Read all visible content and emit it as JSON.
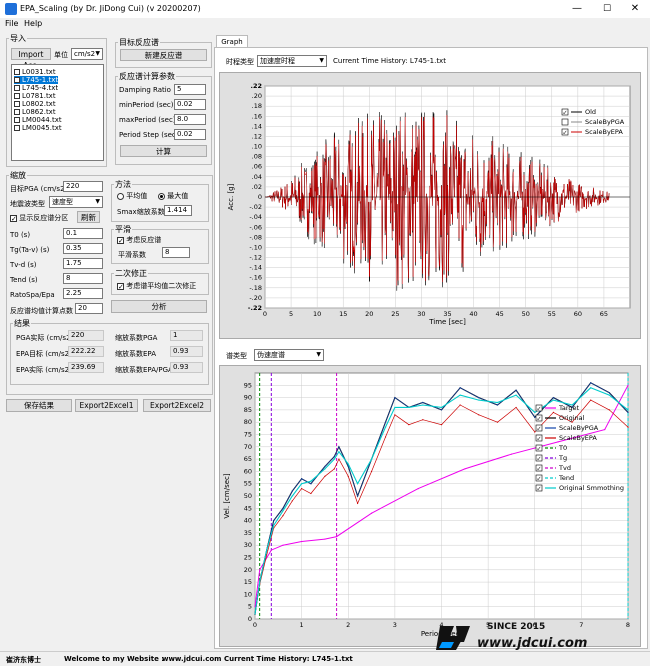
{
  "window": {
    "title": "EPA_Scaling (by Dr. JiDong Cui) (v 20200207)",
    "min_glyph": "—",
    "max_glyph": "☐",
    "close_glyph": "✕"
  },
  "menu": {
    "file": "File",
    "help": "Help"
  },
  "import_group": {
    "label": "导入",
    "import_button": "Import Acc.",
    "unit_label": "单位",
    "unit_value": "cm/s2",
    "files": [
      {
        "name": "L0031.txt",
        "checked": false,
        "selected": false
      },
      {
        "name": "L745-1.txt",
        "checked": false,
        "selected": true
      },
      {
        "name": "L745-4.txt",
        "checked": false,
        "selected": false
      },
      {
        "name": "L0781.txt",
        "checked": false,
        "selected": false
      },
      {
        "name": "L0802.txt",
        "checked": false,
        "selected": false
      },
      {
        "name": "L0862.txt",
        "checked": false,
        "selected": false
      },
      {
        "name": "LM0044.txt",
        "checked": false,
        "selected": false
      },
      {
        "name": "LM0045.txt",
        "checked": false,
        "selected": false
      }
    ]
  },
  "target_spectrum_group": {
    "label": "目标反应谱",
    "new_button": "新建反应谱"
  },
  "spectrum_params": {
    "label": "反应谱计算参数",
    "damping_label": "Damping Ratio",
    "damping_value": "5",
    "minperiod_label": "minPeriod (sec)",
    "minperiod_value": "0.02",
    "maxperiod_label": "maxPeriod (sec)",
    "maxperiod_value": "8.0",
    "step_label": "Period Step (sec)",
    "step_value": "0.02",
    "calc_button": "计算"
  },
  "scaling_group": {
    "label": "缩放",
    "target_pga_label": "目标PGA (cm/s2)",
    "target_pga_value": "220",
    "site_type_label": "地震波类型",
    "site_type_value": "速度型",
    "show_spectrum_label": "显示反应谱分区",
    "refresh_button": "刷新",
    "t0_label": "T0 (s)",
    "t0_value": "0.1",
    "tg_label": "Tg(Ta-v) (s)",
    "tg_value": "0.35",
    "tvd_label": "Tv-d (s)",
    "tvd_value": "1.75",
    "tend_label": "Tend (s)",
    "tend_value": "8",
    "ratio_label": "RatoSpa/Epa",
    "ratio_value": "2.25",
    "points_label": "反应谱均值计算点数",
    "points_value": "20"
  },
  "method_group": {
    "label": "方法",
    "avg_label": "平均值",
    "max_label": "最大值",
    "smax_label": "Smax缩放系数",
    "smax_value": "1.414"
  },
  "smooth_group": {
    "label": "平滑",
    "consider_label": "考虑反应谱",
    "coef_label": "平滑系数",
    "coef_value": "8"
  },
  "second_fix_group": {
    "label": "二次修正",
    "consider_label": "考虑谱平均值二次修正",
    "analyze_button": "分析"
  },
  "results_group": {
    "label": "结果",
    "pga_actual_label": "PGA实际 (cm/s2)",
    "pga_actual_value": "220",
    "epa_target_label": "EPA目标 (cm/s2)",
    "epa_target_value": "222.22",
    "epa_actual_label": "EPA实际 (cm/s2)",
    "epa_actual_value": "239.69",
    "scale_pga_label": "缩放系数PGA",
    "scale_pga_value": "1",
    "scale_epa_label": "缩放系数EPA",
    "scale_epa_value": "0.93",
    "scale_ratio_label": "缩放系数EPA/PGA",
    "scale_ratio_value": "0.93"
  },
  "bottom_buttons": {
    "save": "保存结果",
    "excel1": "Export2Excel1",
    "excel2": "Export2Excel2"
  },
  "graph": {
    "tab_label": "Graph",
    "history_type_label": "时程类型",
    "history_type_value": "加速度时程",
    "current_history": "Current Time History: L745-1.txt",
    "spectrum_type_label": "谱类型",
    "spectrum_type_value": "伪速度谱"
  },
  "colors": {
    "accent": "#0078d7",
    "old": "#000000",
    "epa": "#cc0000",
    "target": "#ee00ee",
    "smoothing": "#00cccc",
    "tvd": "#cc00cc",
    "tg": "#8800dd",
    "t0": "#008800"
  },
  "watermark": {
    "since": "SINCE 2015",
    "site": "www.jdcui.com"
  },
  "status": {
    "author": "崔济东博士",
    "welcome": "Welcome to my Website :",
    "site": "www.jdcui.com",
    "current": "Current Time History: L745-1.txt"
  },
  "chart_data": [
    {
      "type": "line",
      "title": "",
      "xlabel": "Time [sec]",
      "ylabel": "Acc. [g]",
      "xlim": [
        0,
        70
      ],
      "ylim": [
        -0.22,
        0.22
      ],
      "x_ticks": [
        0,
        5,
        10,
        15,
        20,
        25,
        30,
        35,
        40,
        45,
        50,
        55,
        60,
        65
      ],
      "y_ticks": [
        -0.22,
        -0.2,
        -0.18,
        -0.16,
        -0.14,
        -0.12,
        -0.1,
        -0.08,
        -0.06,
        -0.04,
        -0.02,
        0,
        0.02,
        0.04,
        0.06,
        0.08,
        0.1,
        0.12,
        0.14,
        0.16,
        0.18,
        0.2,
        0.22
      ],
      "legend": [
        "Old",
        "ScaleByPGA",
        "ScaleByEPA"
      ],
      "legend_checked": [
        true,
        false,
        true
      ],
      "legend_position": "top-right",
      "series": [
        {
          "name": "Old",
          "envelope": {
            "x": [
              0,
              4,
              8,
              12,
              16,
              20,
              24,
              28,
              32,
              36,
              40,
              44,
              48,
              52,
              56,
              60,
              66
            ],
            "amplitude": [
              0.0,
              0.03,
              0.08,
              0.12,
              0.15,
              0.17,
              0.18,
              0.2,
              0.19,
              0.17,
              0.15,
              0.12,
              0.1,
              0.08,
              0.05,
              0.03,
              0.01
            ]
          }
        },
        {
          "name": "ScaleByEPA",
          "envelope": {
            "x": [
              0,
              4,
              8,
              12,
              16,
              20,
              24,
              28,
              32,
              36,
              40,
              44,
              48,
              52,
              56,
              60,
              66
            ],
            "amplitude": [
              0.0,
              0.03,
              0.07,
              0.11,
              0.14,
              0.16,
              0.17,
              0.19,
              0.18,
              0.16,
              0.14,
              0.11,
              0.09,
              0.07,
              0.05,
              0.03,
              0.01
            ]
          }
        }
      ],
      "peaks": {
        "max": 0.22,
        "min": -0.22
      }
    },
    {
      "type": "line",
      "title": "",
      "xlabel": "Period [sec]",
      "ylabel": "Vel. [cm/sec]",
      "xlim": [
        0,
        8
      ],
      "ylim": [
        0,
        100
      ],
      "x_ticks": [
        0,
        1,
        2,
        3,
        4,
        5,
        6,
        7,
        8
      ],
      "y_ticks": [
        0,
        5,
        10,
        15,
        20,
        25,
        30,
        35,
        40,
        45,
        50,
        55,
        60,
        65,
        70,
        75,
        80,
        85,
        90,
        95
      ],
      "legend": [
        "Target",
        "Original",
        "ScaleByPGA",
        "ScaleByEPA",
        "T0",
        "Tg",
        "Tvd",
        "Tend",
        "Original Smmothing"
      ],
      "legend_position": "right",
      "vlines": {
        "T0": 0.1,
        "Tg": 0.35,
        "Tvd": 1.75,
        "Tend": 8
      },
      "series": [
        {
          "name": "Target",
          "x": [
            0,
            0.1,
            0.35,
            0.6,
            1.0,
            1.5,
            1.75,
            2.5,
            3.5,
            4.5,
            5.5,
            6.5,
            7.5,
            8.0
          ],
          "y": [
            5,
            20,
            28,
            30,
            31.5,
            32.5,
            33.5,
            43,
            53,
            61,
            67,
            72,
            77,
            95
          ]
        },
        {
          "name": "Original",
          "x": [
            0,
            0.1,
            0.25,
            0.4,
            0.6,
            0.8,
            1.0,
            1.2,
            1.5,
            1.7,
            1.8,
            2.0,
            2.2,
            2.5,
            2.8,
            3.0,
            3.3,
            3.6,
            4.0,
            4.4,
            4.8,
            5.2,
            5.6,
            6.0,
            6.4,
            6.8,
            7.2,
            7.6,
            8.0
          ],
          "y": [
            2,
            15,
            28,
            40,
            45,
            52,
            57,
            55,
            62,
            66,
            70,
            62,
            50,
            65,
            80,
            90,
            86,
            88,
            85,
            94,
            90,
            87,
            93,
            82,
            90,
            86,
            96,
            92,
            84
          ]
        },
        {
          "name": "ScaleByPGA",
          "x": [
            0,
            0.1,
            0.25,
            0.4,
            0.6,
            0.8,
            1.0,
            1.2,
            1.5,
            1.7,
            1.8,
            2.0,
            2.2,
            2.5,
            2.8,
            3.0,
            3.3,
            3.6,
            4.0,
            4.4,
            4.8,
            5.2,
            5.6,
            6.0,
            6.4,
            6.8,
            7.2,
            7.6,
            8.0
          ],
          "y": [
            2,
            15,
            28,
            40,
            45,
            52,
            57,
            55,
            62,
            66,
            70,
            62,
            50,
            65,
            80,
            90,
            86,
            88,
            85,
            94,
            90,
            87,
            93,
            82,
            90,
            86,
            96,
            92,
            84
          ]
        },
        {
          "name": "ScaleByEPA",
          "x": [
            0,
            0.1,
            0.25,
            0.4,
            0.6,
            0.8,
            1.0,
            1.2,
            1.5,
            1.7,
            1.8,
            2.0,
            2.2,
            2.5,
            2.8,
            3.0,
            3.3,
            3.6,
            4.0,
            4.4,
            4.8,
            5.2,
            5.6,
            6.0,
            6.4,
            6.8,
            7.2,
            7.6,
            8.0
          ],
          "y": [
            2,
            14,
            26,
            37,
            42,
            48,
            53,
            51,
            58,
            61,
            65,
            58,
            47,
            60,
            74,
            83,
            79,
            81,
            79,
            87,
            83,
            80,
            86,
            76,
            84,
            80,
            89,
            85,
            78
          ]
        },
        {
          "name": "Original Smmothing",
          "x": [
            0,
            0.1,
            0.25,
            0.4,
            0.6,
            0.8,
            1.0,
            1.2,
            1.5,
            1.7,
            1.8,
            2.0,
            2.2,
            2.5,
            2.8,
            3.0,
            3.3,
            3.6,
            4.0,
            4.4,
            4.8,
            5.2,
            5.6,
            6.0,
            6.4,
            6.8,
            7.2,
            7.6,
            8.0
          ],
          "y": [
            2,
            15,
            28,
            38,
            44,
            50,
            55,
            56,
            61,
            65,
            68,
            63,
            55,
            65,
            78,
            86,
            86,
            87,
            86,
            91,
            89,
            88,
            91,
            84,
            89,
            87,
            94,
            91,
            85
          ]
        }
      ]
    }
  ]
}
